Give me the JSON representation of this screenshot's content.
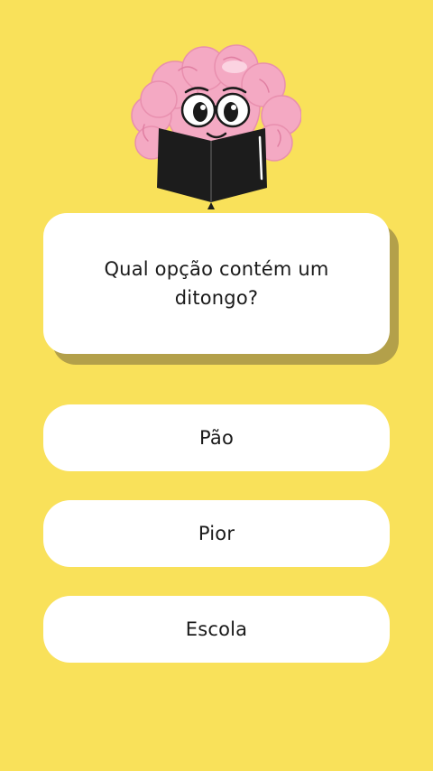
{
  "question": {
    "text": "Qual opção contém um ditongo?"
  },
  "answers": [
    {
      "label": "Pão"
    },
    {
      "label": "Pior"
    },
    {
      "label": "Escola"
    }
  ],
  "mascot": {
    "icon": "brain-reading-book-icon"
  },
  "colors": {
    "background": "#f9e15a",
    "card": "#ffffff",
    "card_shadow": "#b3a04a",
    "brain": "#f4a9c3",
    "book": "#1c1c1c"
  }
}
